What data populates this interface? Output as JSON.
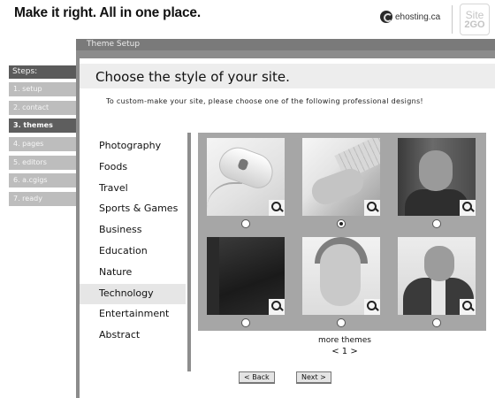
{
  "header": {
    "tagline": "Make it right.  All in one place.",
    "brand": "ehosting.ca",
    "product_line1": "Site",
    "product_line2": "2GO"
  },
  "steps": {
    "title": "Steps:",
    "items": [
      {
        "label": "1. setup",
        "active": false
      },
      {
        "label": "2. contact",
        "active": false
      },
      {
        "label": "3. themes",
        "active": true
      },
      {
        "label": "4. pages",
        "active": false
      },
      {
        "label": "5. editors",
        "active": false
      },
      {
        "label": "6. a.cgigs",
        "active": false
      },
      {
        "label": "7. ready",
        "active": false
      }
    ]
  },
  "window": {
    "title": "Theme Setup",
    "heading": "Choose the style of your site.",
    "subline": "To custom-make your site, please choose one of the following professional designs!"
  },
  "categories": [
    {
      "label": "Photography",
      "selected": false
    },
    {
      "label": "Foods",
      "selected": false
    },
    {
      "label": "Travel",
      "selected": false
    },
    {
      "label": "Sports & Games",
      "selected": false
    },
    {
      "label": "Business",
      "selected": false
    },
    {
      "label": "Education",
      "selected": false
    },
    {
      "label": "Nature",
      "selected": false
    },
    {
      "label": "Technology",
      "selected": true
    },
    {
      "label": "Entertainment",
      "selected": false
    },
    {
      "label": "Abstract",
      "selected": false
    }
  ],
  "themes": [
    {
      "image": "computer-mouse",
      "selected": false
    },
    {
      "image": "hands-on-keyboard",
      "selected": true
    },
    {
      "image": "man-portrait",
      "selected": false
    },
    {
      "image": "dark-photo",
      "selected": false
    },
    {
      "image": "woman-face",
      "selected": false
    },
    {
      "image": "man-on-phone",
      "selected": false
    }
  ],
  "pagination": {
    "more_label": "more themes",
    "pager": "< 1 >"
  },
  "buttons": {
    "back": "< Back",
    "next": "Next >"
  },
  "colors": {
    "frame": "#8c8c8c",
    "active_step": "#5e5e5e",
    "inactive_step": "#bdbdbd"
  }
}
